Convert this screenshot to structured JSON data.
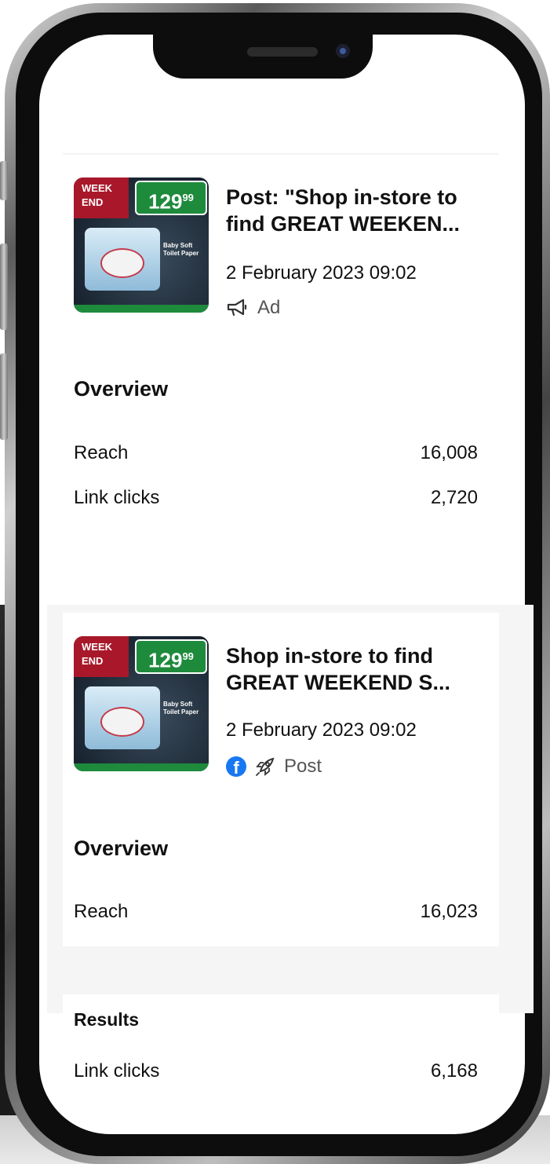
{
  "posts": [
    {
      "title": "Post: \"Shop in-store to find GREAT WEEKEN...",
      "date": "2 February 2023 09:02",
      "type_label": "Ad",
      "thumbnail": {
        "price": "129",
        "cents": "99",
        "week": "WEEK",
        "end": "END",
        "brand": "Baby Soft",
        "desc": "Toilet Paper"
      },
      "overview_heading": "Overview",
      "metrics": [
        {
          "label": "Reach",
          "value": "16,008"
        },
        {
          "label": "Link clicks",
          "value": "2,720"
        }
      ]
    },
    {
      "title": "Shop in-store to find GREAT WEEKEND S...",
      "date": "2 February 2023 09:02",
      "type_label": "Post",
      "thumbnail": {
        "price": "129",
        "cents": "99",
        "week": "WEEK",
        "end": "END",
        "brand": "Baby Soft",
        "desc": "Toilet Paper"
      },
      "overview_heading": "Overview",
      "metrics": [
        {
          "label": "Reach",
          "value": "16,023"
        }
      ],
      "results_heading": "Results",
      "results": [
        {
          "label": "Link clicks",
          "value": "6,168"
        }
      ]
    }
  ],
  "colors": {
    "facebook_blue": "#1877f2",
    "price_green": "#1e8a3c",
    "week_red": "#a8182a"
  },
  "icons": {
    "ad": "megaphone-icon",
    "facebook": "facebook-icon",
    "boost": "rocket-icon"
  }
}
